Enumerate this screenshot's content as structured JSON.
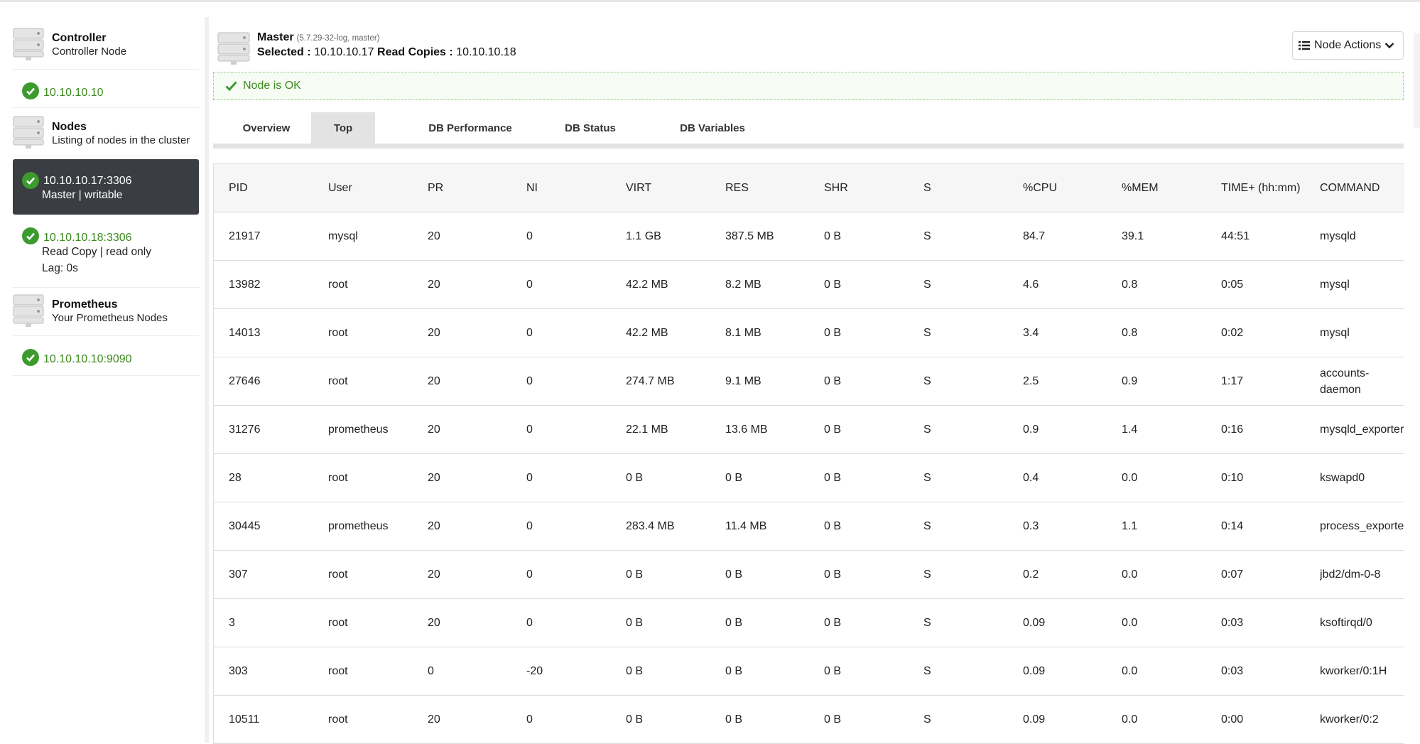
{
  "sidebar": {
    "controller": {
      "title": "Controller",
      "subtitle": "Controller Node",
      "icon": "server-icon"
    },
    "controller_nodes": [
      {
        "ip": "10.10.10.10",
        "status": "ok"
      }
    ],
    "nodes": {
      "title": "Nodes",
      "subtitle": "Listing of nodes in the cluster",
      "icon": "server-icon"
    },
    "cluster_nodes": [
      {
        "ip": "10.10.10.17:3306",
        "line1": "Master | writable",
        "line2": "",
        "selected": true
      },
      {
        "ip": "10.10.10.18:3306",
        "line1": "Read Copy | read only",
        "line2": "Lag: 0s",
        "selected": false
      }
    ],
    "prometheus": {
      "title": "Prometheus",
      "subtitle": "Your Prometheus Nodes",
      "icon": "server-icon"
    },
    "prometheus_nodes": [
      {
        "ip": "10.10.10.10:9090",
        "status": "ok"
      }
    ]
  },
  "header": {
    "title": "Master",
    "version": "(5.7.29-32-log, master)",
    "selected_label": "Selected :",
    "selected_value": "10.10.10.17",
    "read_copies_label": "Read Copies :",
    "read_copies_value": "10.10.10.18",
    "node_actions_label": "Node Actions"
  },
  "alert": {
    "text": "Node is OK",
    "color": "#3c8a1e"
  },
  "tabs": [
    {
      "label": "Overview",
      "active": false
    },
    {
      "label": "Top",
      "active": true
    },
    {
      "label": "DB Performance",
      "active": false
    },
    {
      "label": "DB Status",
      "active": false
    },
    {
      "label": "DB Variables",
      "active": false
    }
  ],
  "table": {
    "headers": [
      "PID",
      "User",
      "PR",
      "NI",
      "VIRT",
      "RES",
      "SHR",
      "S",
      "%CPU",
      "%MEM",
      "TIME+ (hh:mm)",
      "COMMAND"
    ],
    "rows": [
      [
        "21917",
        "mysql",
        "20",
        "0",
        "1.1 GB",
        "387.5 MB",
        "0 B",
        "S",
        "84.7",
        "39.1",
        "44:51",
        "mysqld"
      ],
      [
        "13982",
        "root",
        "20",
        "0",
        "42.2 MB",
        "8.2 MB",
        "0 B",
        "S",
        "4.6",
        "0.8",
        "0:05",
        "mysql"
      ],
      [
        "14013",
        "root",
        "20",
        "0",
        "42.2 MB",
        "8.1 MB",
        "0 B",
        "S",
        "3.4",
        "0.8",
        "0:02",
        "mysql"
      ],
      [
        "27646",
        "root",
        "20",
        "0",
        "274.7 MB",
        "9.1 MB",
        "0 B",
        "S",
        "2.5",
        "0.9",
        "1:17",
        "accounts-daemon"
      ],
      [
        "31276",
        "prometheus",
        "20",
        "0",
        "22.1 MB",
        "13.6 MB",
        "0 B",
        "S",
        "0.9",
        "1.4",
        "0:16",
        "mysqld_exporter"
      ],
      [
        "28",
        "root",
        "20",
        "0",
        "0 B",
        "0 B",
        "0 B",
        "S",
        "0.4",
        "0.0",
        "0:10",
        "kswapd0"
      ],
      [
        "30445",
        "prometheus",
        "20",
        "0",
        "283.4 MB",
        "11.4 MB",
        "0 B",
        "S",
        "0.3",
        "1.1",
        "0:14",
        "process_exporter"
      ],
      [
        "307",
        "root",
        "20",
        "0",
        "0 B",
        "0 B",
        "0 B",
        "S",
        "0.2",
        "0.0",
        "0:07",
        "jbd2/dm-0-8"
      ],
      [
        "3",
        "root",
        "20",
        "0",
        "0 B",
        "0 B",
        "0 B",
        "S",
        "0.09",
        "0.0",
        "0:03",
        "ksoftirqd/0"
      ],
      [
        "303",
        "root",
        "0",
        "-20",
        "0 B",
        "0 B",
        "0 B",
        "S",
        "0.09",
        "0.0",
        "0:03",
        "kworker/0:1H"
      ],
      [
        "10511",
        "root",
        "20",
        "0",
        "0 B",
        "0 B",
        "0 B",
        "S",
        "0.09",
        "0.0",
        "0:00",
        "kworker/0:2"
      ]
    ]
  },
  "colors": {
    "ok_green": "#3c9a2e",
    "selected_bg": "#3a3d42",
    "tab_active_bg": "#e3e3e3"
  }
}
